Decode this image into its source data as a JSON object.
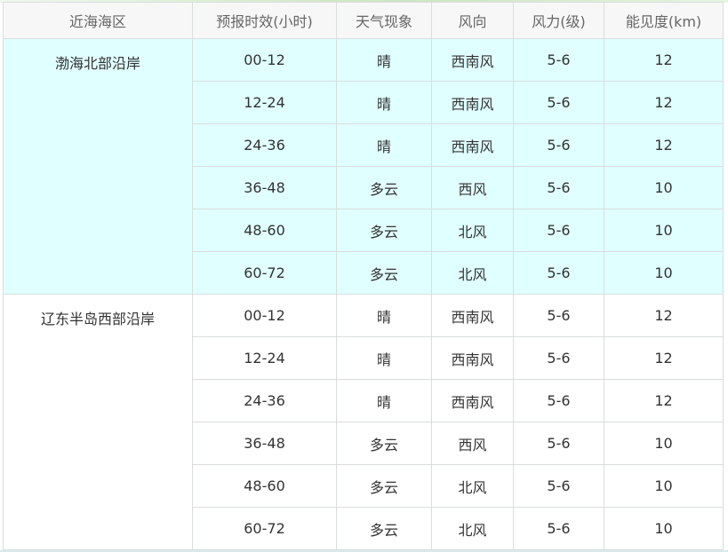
{
  "table": {
    "headers": [
      "近海海区",
      "预报时效(小时)",
      "天气现象",
      "风向",
      "风力(级)",
      "能见度(km)"
    ],
    "groups": [
      {
        "region": "渤海北部沿岸",
        "rows": [
          [
            "00-12",
            "晴",
            "西南风",
            "5-6",
            "12"
          ],
          [
            "12-24",
            "晴",
            "西南风",
            "5-6",
            "12"
          ],
          [
            "24-36",
            "晴",
            "西南风",
            "5-6",
            "12"
          ],
          [
            "36-48",
            "多云",
            "西风",
            "5-6",
            "10"
          ],
          [
            "48-60",
            "多云",
            "北风",
            "5-6",
            "10"
          ],
          [
            "60-72",
            "多云",
            "北风",
            "5-6",
            "10"
          ]
        ]
      },
      {
        "region": "辽东半岛西部沿岸",
        "rows": [
          [
            "00-12",
            "晴",
            "西南风",
            "5-6",
            "12"
          ],
          [
            "12-24",
            "晴",
            "西南风",
            "5-6",
            "12"
          ],
          [
            "24-36",
            "晴",
            "西南风",
            "5-6",
            "12"
          ],
          [
            "36-48",
            "多云",
            "西风",
            "5-6",
            "10"
          ],
          [
            "48-60",
            "多云",
            "北风",
            "5-6",
            "10"
          ],
          [
            "60-72",
            "多云",
            "北风",
            "5-6",
            "10"
          ]
        ]
      }
    ]
  },
  "colors": {
    "highlight_group_background": "#e0ffff",
    "header_background": "#f7f7f7",
    "border": "#d9dedd",
    "text": "#333333"
  }
}
